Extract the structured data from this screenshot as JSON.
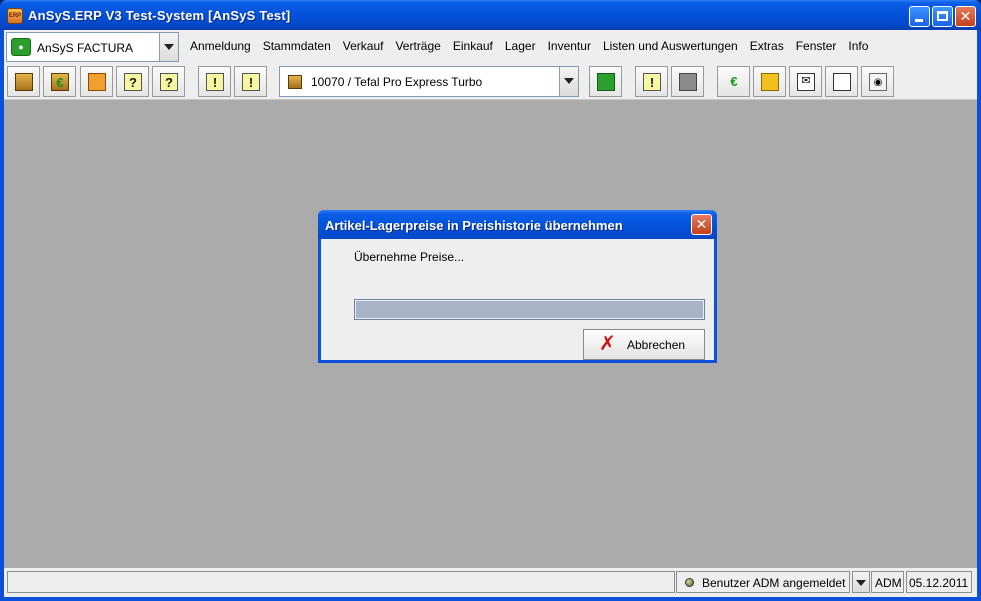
{
  "window": {
    "title": "AnSyS.ERP V3 Test-System [AnSyS Test]",
    "app_icon_text": "ERP"
  },
  "module_selector": {
    "value": "AnSyS FACTURA"
  },
  "menu": {
    "items": [
      "Anmeldung",
      "Stammdaten",
      "Verkauf",
      "Verträge",
      "Einkauf",
      "Lager",
      "Inventur",
      "Listen und Auswertungen",
      "Extras",
      "Fenster",
      "Info"
    ]
  },
  "toolbar": {
    "article_selector_value": "10070 / Tefal Pro Express Turbo"
  },
  "dialog": {
    "title": "Artikel-Lagerpreise in Preishistorie übernehmen",
    "message": "Übernehme Preise...",
    "progress_fraction": 1.0,
    "cancel_label": "Abbrechen"
  },
  "statusbar": {
    "user_status": "Benutzer ADM angemeldet",
    "user": "ADM",
    "date": "05.12.2011"
  },
  "colors": {
    "xp_blue": "#0b50d8",
    "desktop_gray": "#ababab",
    "progress_fill": "#a7b4c8"
  }
}
